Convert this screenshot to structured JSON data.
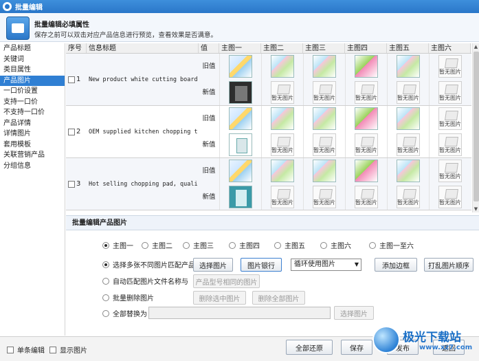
{
  "window": {
    "title": "批量编辑"
  },
  "banner": {
    "heading": "批量编辑必填属性",
    "subtitle": "保存之前可以双击对应产品信息进行预览，查看效果是否满意。"
  },
  "sidebar": {
    "items": [
      "产品标题",
      "关键词",
      "类目属性",
      "产品图片",
      "一口价设置",
      "支持一口价",
      "不支持一口价",
      "产品详情",
      "详情图片",
      "套用模板",
      "关联营销产品",
      "分组信息"
    ],
    "active_index": 3
  },
  "grid": {
    "headers": [
      "序号",
      "信息标题",
      "值",
      "主图一",
      "主图二",
      "主图三",
      "主图四",
      "主图五",
      "主图六"
    ],
    "old_label": "旧值",
    "new_label": "新值",
    "placeholder_text": "暂无图片",
    "rows": [
      {
        "no": "1",
        "title": "New product white cutting board..."
      },
      {
        "no": "2",
        "title": "OEM supplied kitchen chopping t..."
      },
      {
        "no": "3",
        "title": "Hot selling chopping pad, quali..."
      }
    ]
  },
  "section": {
    "title": "批量编辑产品图片"
  },
  "image_choices": {
    "options": [
      "主图一",
      "主图二",
      "主图三",
      "主图四",
      "主图五",
      "主图六",
      "主图一至六"
    ],
    "selected_index": 0
  },
  "operations": {
    "multi_match": {
      "label": "选择多张不同图片匹配产品",
      "select_btn": "选择图片",
      "bank_btn": "图片银行",
      "mode_value": "循环使用图片",
      "border_btn": "添加边框",
      "shuffle_btn": "打乱图片顺序"
    },
    "auto_match": {
      "label": "自动匹配图片文件名称与",
      "btn": "产品型号相同的图片"
    },
    "batch_delete": {
      "label": "批量删除图片",
      "del_selected": "删除选中图片",
      "del_all": "删除全部图片"
    },
    "replace_all": {
      "label": "全部替换为",
      "select_btn": "选择图片"
    }
  },
  "footer": {
    "single_edit": "单条编辑",
    "show_images": "显示图片",
    "restore_btn": "全部还原",
    "save_btn": "保存",
    "publish_btn": "发布",
    "back_btn": "返回"
  },
  "watermark": {
    "brand": "极光下载站",
    "url": "www.xz7.com"
  }
}
